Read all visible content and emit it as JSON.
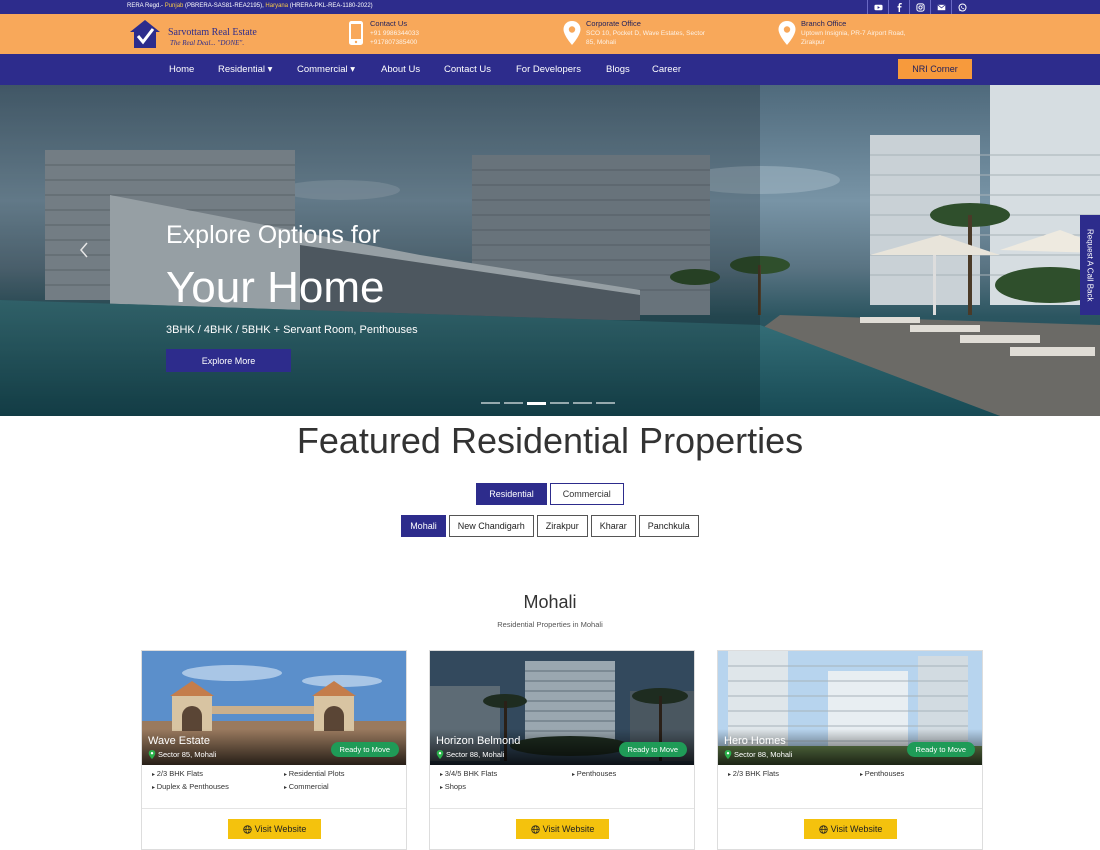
{
  "top_strip": {
    "rera_prefix": "RERA Regd.- ",
    "punjab": "Punjab",
    "rera_text": " (PBRERA-SAS81-REA2195), ",
    "haryana": "Haryana",
    "rera_text_2": " (HRERA-PKL-REA-1180-2022)",
    "social_icons": [
      "youtube-icon",
      "facebook-icon",
      "instagram-icon",
      "mail-icon",
      "whatsapp-icon"
    ]
  },
  "header": {
    "brand_name": "Sarvottam Real Estate",
    "tagline": "The Real Deal... \"DONE\".",
    "contact": {
      "title": "Contact Us",
      "line1": "+91 9986344033",
      "line2": "+917807385400"
    },
    "corporate": {
      "title": "Corporate Office",
      "line1": "SCO 10, Pocket D, Wave Estates, Sector",
      "line2": "85, Mohali"
    },
    "branch": {
      "title": "Branch Office",
      "line1": "Uptown Insignia, PR-7 Airport Road,",
      "line2": "Zirakpur"
    }
  },
  "nav": {
    "items": [
      "Home",
      "Residential ▾",
      "Commercial ▾",
      "About Us",
      "Contact Us",
      "For Developers",
      "Blogs",
      "Career"
    ],
    "nri_button": "NRI Corner"
  },
  "hero": {
    "line_small": "Explore Options for",
    "line_big": "Your Home",
    "subtitle": "3BHK / 4BHK / 5BHK + Servant Room, Penthouses",
    "cta": "Explore More",
    "callback": "Request A Call Back",
    "slides": 6,
    "active_slide": 3
  },
  "featured": {
    "title": "Featured Residential Properties",
    "tabs": [
      "Residential",
      "Commercial"
    ],
    "active_tab": "Residential",
    "cities": [
      "Mohali",
      "New Chandigarh",
      "Zirakpur",
      "Kharar",
      "Panchkula"
    ],
    "active_city": "Mohali",
    "city_title": "Mohali",
    "city_subtitle": "Residential Properties in Mohali"
  },
  "cards": [
    {
      "name": "Wave Estate",
      "location": "Sector 85, Mohali",
      "status": "Ready to Move",
      "features": [
        "2/3 BHK Flats",
        "Residential Plots",
        "Duplex & Penthouses",
        "Commercial"
      ],
      "cta": "Visit Website"
    },
    {
      "name": "Horizon Belmond",
      "location": "Sector 88, Mohali",
      "status": "Ready to Move",
      "features": [
        "3/4/5 BHK Flats",
        "Penthouses",
        "Shops"
      ],
      "cta": "Visit Website"
    },
    {
      "name": "Hero Homes",
      "location": "Sector 88, Mohali",
      "status": "Ready to Move",
      "features": [
        "2/3 BHK Flats",
        "Penthouses"
      ],
      "cta": "Visit Website"
    }
  ],
  "colors": {
    "brand_blue": "#2d2c8c",
    "orange": "#f8a85a",
    "status_green": "#1f9b57",
    "cta_yellow": "#f4c20d"
  }
}
